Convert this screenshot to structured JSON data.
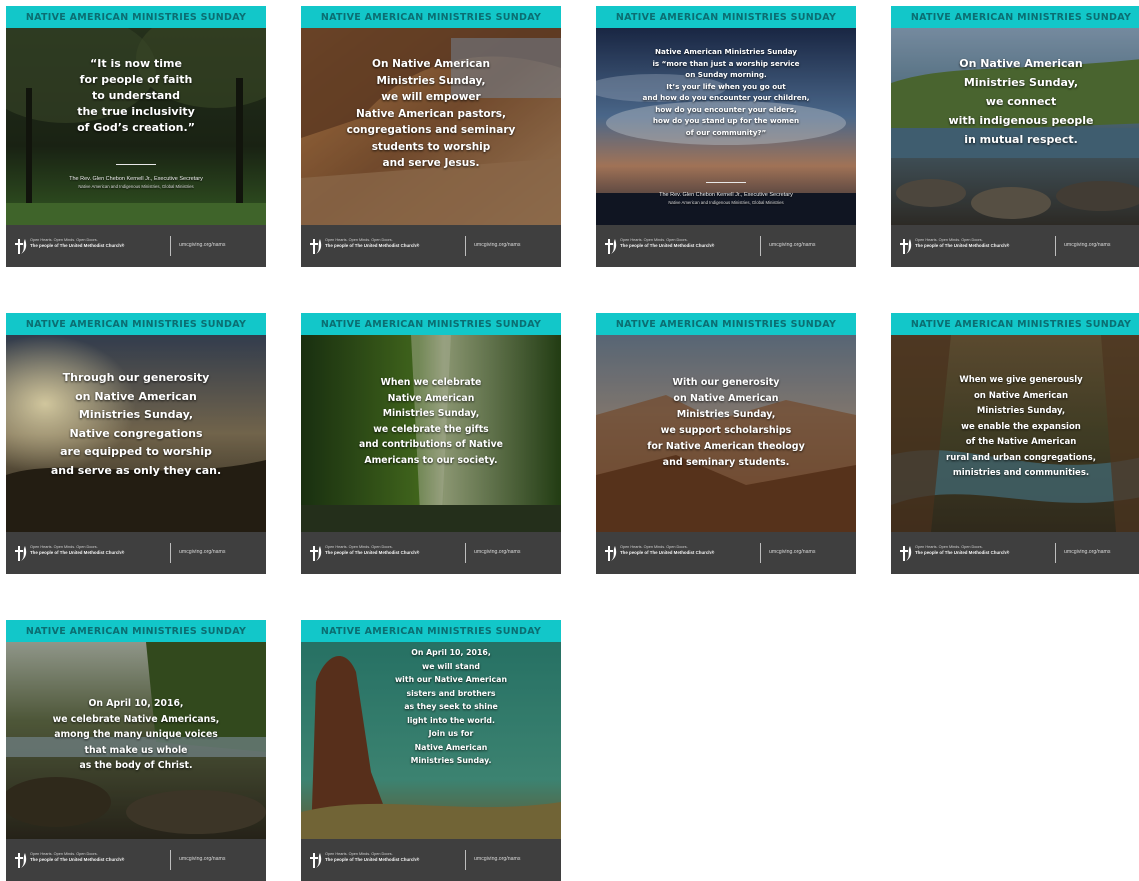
{
  "banner_text": "NATIVE AMERICAN MINISTRIES SUNDAY",
  "footer": {
    "tagline_top": "Open Hearts. Open Minds. Open Doors.",
    "tagline_bottom": "The people of The United Methodist Church®",
    "url": "umcgiving.org/nams"
  },
  "cards": [
    {
      "message": "“It is now time\nfor people of faith\nto understand\nthe true inclusivity\nof God’s creation.”",
      "attribution": "The Rev. Glen Chebon Kernell Jr., Executive Secretary",
      "attribution_sub": "Native American and Indigenous Ministries, Global Ministries"
    },
    {
      "message": "On Native American\nMinistries Sunday,\nwe will empower\nNative American pastors,\ncongregations and seminary\nstudents to worship\nand serve Jesus."
    },
    {
      "message": "Native American Ministries Sunday\nis “more than just a worship service\non Sunday morning.\nIt’s your life when you go out\nand how do you encounter your children,\nhow do you encounter your elders,\nhow do you stand up for the women\nof our community?”",
      "attribution": "The Rev. Glen Chebon Kernell Jr., Executive Secretary",
      "attribution_sub": "Native American and Indigenous Ministries, Global Ministries"
    },
    {
      "message": "On Native American\nMinistries Sunday,\nwe connect\nwith indigenous people\nin mutual respect."
    },
    {
      "message": "Through our generosity\non Native American\nMinistries Sunday,\nNative congregations\nare equipped to worship\nand serve as only they can."
    },
    {
      "message": "When we celebrate\nNative American\nMinistries Sunday,\nwe celebrate the gifts\nand contributions of Native\nAmericans to our society."
    },
    {
      "message": "With our generosity\non Native American\nMinistries Sunday,\nwe support scholarships\nfor Native American theology\nand seminary students."
    },
    {
      "message": "When we give generously\non Native American\nMinistries Sunday,\nwe enable the expansion\nof the Native American\nrural and urban congregations,\nministries and communities."
    },
    {
      "message": "On April 10, 2016,\nwe celebrate Native Americans,\namong the many unique voices\nthat make us whole\nas the body of Christ."
    },
    {
      "message": "On April 10, 2016,\nwe will stand\nwith our Native American\nsisters and brothers\nas they seek to shine\nlight into the world.\nJoin us for\nNative American\nMinistries Sunday."
    }
  ]
}
